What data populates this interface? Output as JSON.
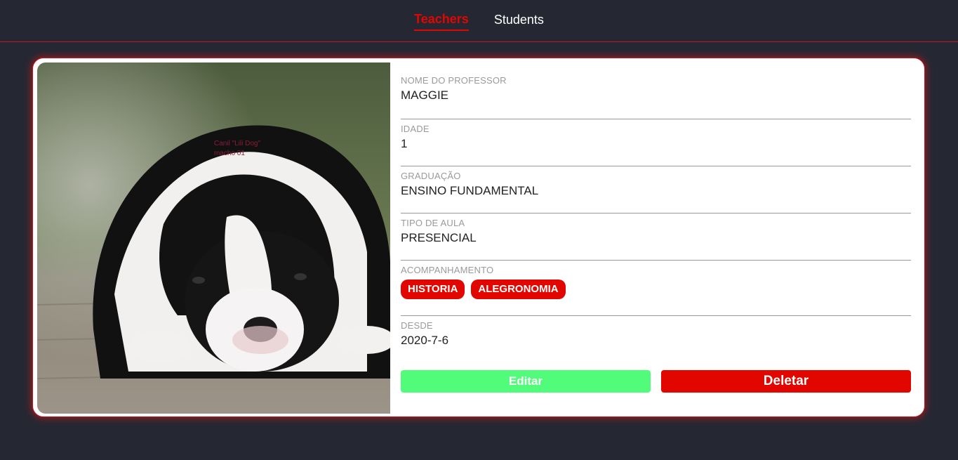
{
  "nav": {
    "items": [
      {
        "label": "Teachers",
        "active": true
      },
      {
        "label": "Students",
        "active": false
      }
    ]
  },
  "teacher": {
    "photo_watermark": [
      "Canil \"Lili Dog\"",
      "macho 01"
    ],
    "fields": [
      {
        "label": "NOME DO PROFESSOR",
        "value": "MAGGIE"
      },
      {
        "label": "IDADE",
        "value": "1"
      },
      {
        "label": "GRADUAÇÃO",
        "value": "ENSINO FUNDAMENTAL"
      },
      {
        "label": "TIPO DE AULA",
        "value": "PRESENCIAL"
      }
    ],
    "subjects": {
      "label": "ACOMPANHAMENTO",
      "tags": [
        "HISTORIA",
        "ALEGRONOMIA"
      ]
    },
    "since": {
      "label": "DESDE",
      "value": "2020-7-6"
    }
  },
  "actions": {
    "edit_label": "Editar",
    "delete_label": "Deletar"
  },
  "colors": {
    "background": "#252833",
    "accent": "#e10600",
    "edit": "#50fc7a"
  }
}
